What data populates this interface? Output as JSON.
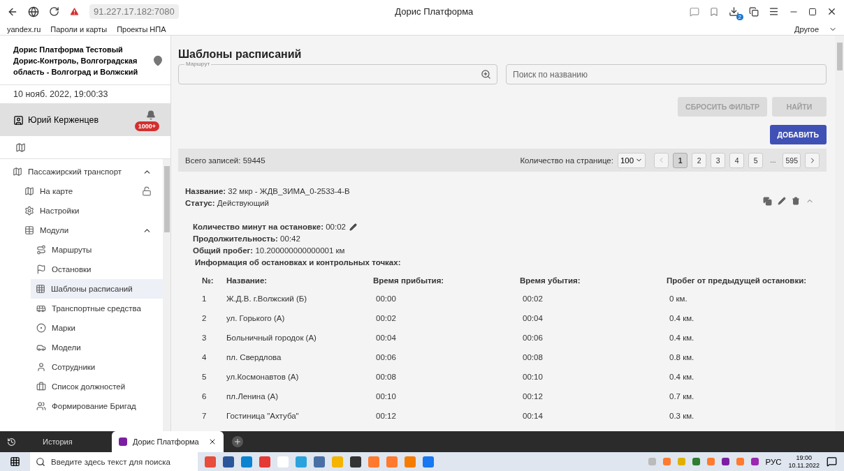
{
  "browser": {
    "url": "91.227.17.182:7080",
    "title": "Дорис Платформа",
    "downloads_count": "2",
    "bookmarks": [
      "yandex.ru",
      "Пароли и карты",
      "Проекты НПА"
    ],
    "other_bookmarks": "Другое"
  },
  "sidebar": {
    "org": "Дорис Платформа Тестовый Дорис-Контроль, Волгоградская область - Волгоград и Волжский",
    "datetime": "10 нояб. 2022, 19:00:33",
    "user": {
      "name": "Юрий Керженцев",
      "badge": "1000+"
    },
    "nav": [
      {
        "label": "Пассажирский транспорт",
        "expanded": true,
        "selected": false,
        "children": [
          {
            "label": "На карте",
            "selected": false,
            "locked": true
          },
          {
            "label": "Настройки",
            "selected": false
          },
          {
            "label": "Модули",
            "expanded": true,
            "selected": false,
            "children": [
              {
                "label": "Маршруты",
                "selected": false
              },
              {
                "label": "Остановки",
                "selected": false
              },
              {
                "label": "Шаблоны расписаний",
                "selected": true
              },
              {
                "label": "Транспортные средства",
                "selected": false
              },
              {
                "label": "Марки",
                "selected": false
              },
              {
                "label": "Модели",
                "selected": false
              },
              {
                "label": "Сотрудники",
                "selected": false
              },
              {
                "label": "Список должностей",
                "selected": false
              },
              {
                "label": "Формирование Бригад",
                "selected": false
              }
            ]
          }
        ]
      }
    ]
  },
  "main": {
    "title": "Шаблоны расписаний",
    "route_field": {
      "label": "Маршрут"
    },
    "search": {
      "placeholder": "Поиск по названию"
    },
    "buttons": [
      {
        "label": "СБРОСИТЬ ФИЛЬТР",
        "disabled": true
      },
      {
        "label": "НАЙТИ",
        "disabled": true
      }
    ],
    "add_button": "ДОБАВИТЬ",
    "summary": {
      "total": "Всего записей: 59445",
      "per_page_label": "Количество на странице:",
      "per_page": "100",
      "pages": [
        {
          "label": "1",
          "selected": true
        },
        {
          "label": "2",
          "selected": false
        },
        {
          "label": "3",
          "selected": false
        },
        {
          "label": "4",
          "selected": false
        },
        {
          "label": "5",
          "selected": false
        },
        {
          "label": "...",
          "kind": "ellipsis"
        },
        {
          "label": "595",
          "selected": false
        }
      ]
    },
    "record": {
      "name_label": "Название:",
      "name": "32 мкр - ЖДВ_ЗИМА_0-2533-4-В",
      "status_label": "Статус:",
      "status": "Действующий",
      "expanded": true,
      "details": [
        {
          "label": "Количество минут на остановке:",
          "value": "00:02",
          "editable": true
        },
        {
          "label": "Продолжительность:",
          "value": "00:42"
        },
        {
          "label": "Общий пробег:",
          "value": "10.200000000000001 км"
        }
      ],
      "stops_title": "Информация об остановках и контрольных точках:",
      "columns": [
        "№:",
        "Название:",
        "Время прибытия:",
        "Время убытия:",
        "Пробег от предыдущей остановки:"
      ],
      "rows": [
        [
          "1",
          "Ж.Д.В. г.Волжский (Б)",
          "00:00",
          "00:02",
          "0 км."
        ],
        [
          "2",
          "ул. Горького (А)",
          "00:02",
          "00:04",
          "0.4 км."
        ],
        [
          "3",
          "Больничный городок (А)",
          "00:04",
          "00:06",
          "0.4 км."
        ],
        [
          "4",
          "пл. Свердлова",
          "00:06",
          "00:08",
          "0.8 км."
        ],
        [
          "5",
          "ул.Космонавтов (А)",
          "00:08",
          "00:10",
          "0.4 км."
        ],
        [
          "6",
          "пл.Ленина (А)",
          "00:10",
          "00:12",
          "0.7 км."
        ],
        [
          "7",
          "Гостиница \"Ахтуба\"",
          "00:12",
          "00:14",
          "0.3 км."
        ]
      ]
    }
  },
  "tabbar": {
    "history": "История",
    "tabs": [
      {
        "title": "Дорис Платформа",
        "selected": true
      }
    ]
  },
  "taskbar": {
    "search_placeholder": "Введите здесь текст для поиска",
    "lang": "РУС",
    "time": "19:00",
    "date": "10.11.2022"
  }
}
